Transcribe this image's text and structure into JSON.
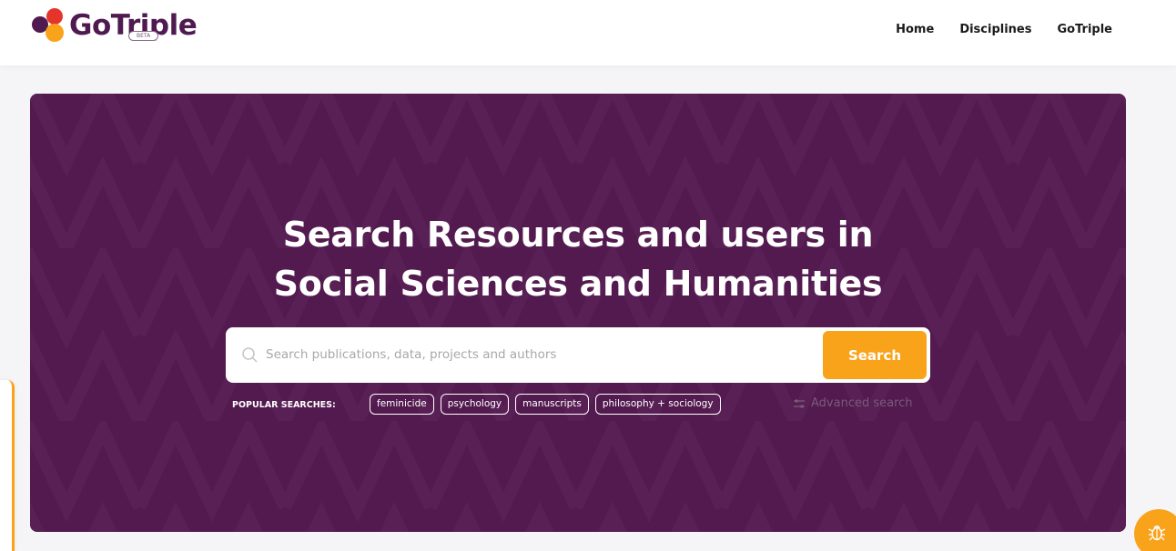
{
  "header": {
    "logo_text": "GoTriple",
    "beta_label": "BETA",
    "nav": [
      "Home",
      "Disciplines",
      "GoTriple"
    ]
  },
  "hero": {
    "title_line1": "Search Resources and users in",
    "title_line2": "Social Sciences and Humanities",
    "search": {
      "placeholder": "Search publications, data, projects and authors",
      "value": "",
      "button_label": "Search"
    },
    "popular_label": "POPULAR SEARCHES:",
    "popular_tags": [
      "feminicide",
      "psychology",
      "manuscripts",
      "philosophy + sociology"
    ],
    "advanced_search_label": "Advanced search"
  },
  "icons": {
    "search": "search-icon",
    "advanced": "sliders-icon",
    "bug": "bug-icon"
  },
  "colors": {
    "brand_purple": "#521a4f",
    "accent_orange": "#f9a31b",
    "logo_red": "#e63946"
  }
}
